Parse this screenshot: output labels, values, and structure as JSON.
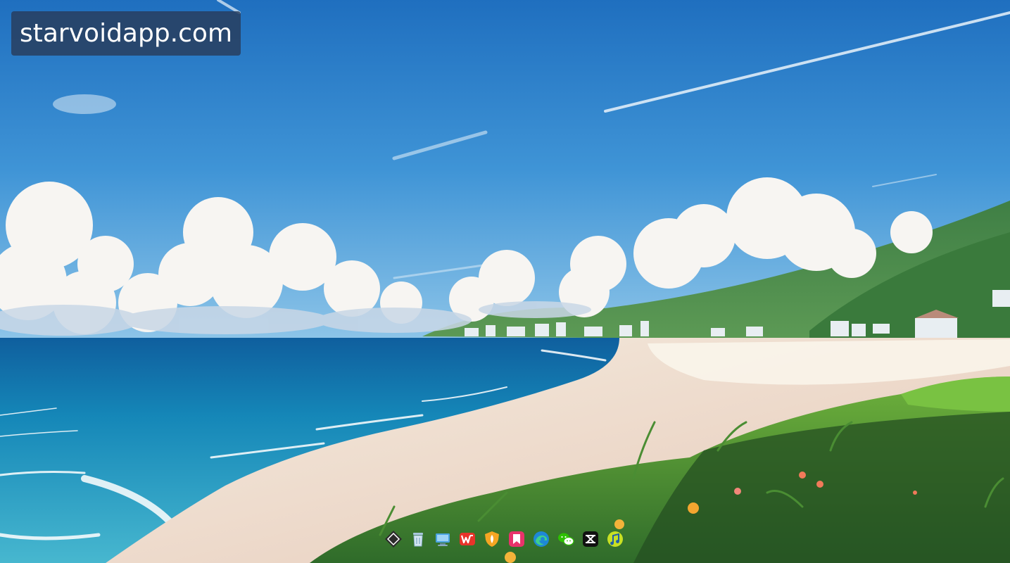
{
  "watermark": {
    "text": "starvoidapp.com"
  },
  "dock": {
    "apps": [
      {
        "name": "nexus-launcher-icon",
        "color": "#2b2b2b"
      },
      {
        "name": "recycle-bin-icon",
        "color": "#d6e6f2"
      },
      {
        "name": "this-pc-icon",
        "color": "#4aa3e0"
      },
      {
        "name": "wps-office-icon",
        "color": "#e8332a"
      },
      {
        "name": "shield-app-icon",
        "color": "#f5a623"
      },
      {
        "name": "bookmark-app-icon",
        "color": "#e8336b"
      },
      {
        "name": "edge-browser-icon",
        "color": "#1e88d6"
      },
      {
        "name": "wechat-icon",
        "color": "#2dc100"
      },
      {
        "name": "capcut-icon",
        "color": "#111111"
      },
      {
        "name": "music-app-icon",
        "color": "#c8e024"
      }
    ]
  }
}
